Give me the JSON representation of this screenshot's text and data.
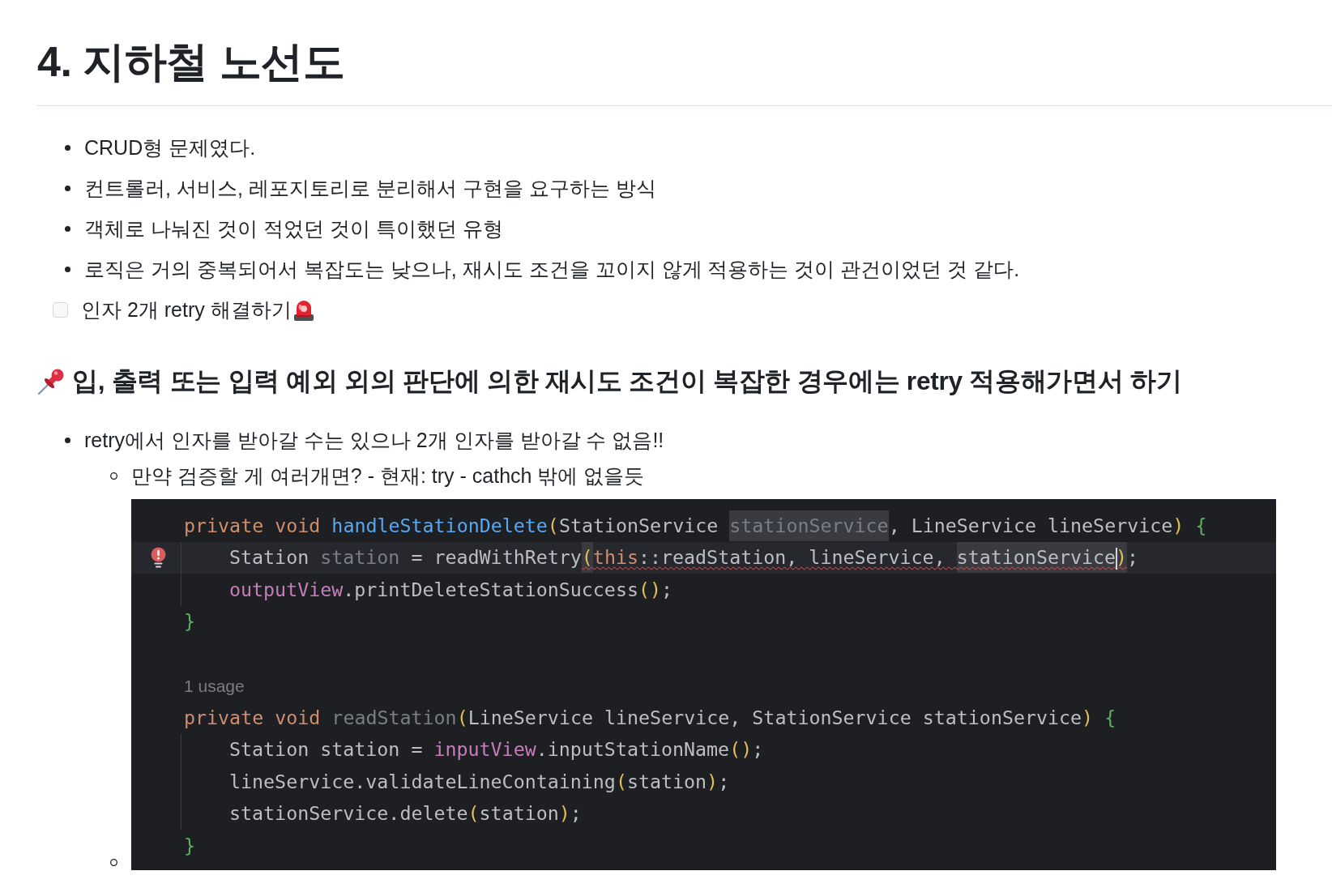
{
  "heading": "4. 지하철 노선도",
  "bullets": [
    "CRUD형 문제였다.",
    "컨트롤러, 서비스, 레포지토리로 분리해서 구현을 요구하는 방식",
    "객체로 나눠진 것이 적었던 것이 특이했던 유형",
    "로직은 거의 중복되어서 복잡도는 낮으나, 재시도 조건을 꼬이지 않게 적용하는 것이 관건이었던 것 같다."
  ],
  "todo": {
    "label": "인자 2개 retry 해결하기",
    "checked": false
  },
  "subheading": "입, 출력 또는 입력 예외 외의 판단에 의한 재시도 조건이 복잡한 경우에는 retry 적용해가면서 하기",
  "notes": [
    {
      "text": "retry에서 인자를 받아갈 수는 있으나 2개 인자를 받아갈 수 없음!!",
      "children": [
        {
          "kind": "text",
          "text": "만약 검증할 게 여러개면? - 현재: try - cathch 밖에 없을듯"
        },
        {
          "kind": "code",
          "lines": [
            {
              "kind": "code",
              "current": false,
              "indented": false,
              "error": false,
              "tokens": [
                {
                  "text": "private ",
                  "kind": "keyword",
                  "highlighted": false
                },
                {
                  "text": "void ",
                  "kind": "keyword",
                  "highlighted": false
                },
                {
                  "text": "handleStationDelete",
                  "kind": "declaration",
                  "highlighted": false
                },
                {
                  "text": "(",
                  "kind": "paren",
                  "highlighted": false
                },
                {
                  "text": "StationService ",
                  "kind": "plain",
                  "highlighted": false
                },
                {
                  "text": "stationService",
                  "kind": "unused",
                  "highlighted": true
                },
                {
                  "text": ", LineService lineService",
                  "kind": "plain",
                  "highlighted": false
                },
                {
                  "text": ") ",
                  "kind": "paren",
                  "highlighted": false
                },
                {
                  "text": "{",
                  "kind": "brace",
                  "highlighted": false
                }
              ]
            },
            {
              "kind": "code",
              "current": true,
              "indented": true,
              "error": true,
              "tokens": [
                {
                  "text": "Station ",
                  "kind": "plain",
                  "highlighted": false,
                  "squiggly": false
                },
                {
                  "text": "station",
                  "kind": "unused",
                  "highlighted": false,
                  "squiggly": false
                },
                {
                  "text": " = readWithRetry",
                  "kind": "plain",
                  "highlighted": false,
                  "squiggly": false
                },
                {
                  "text": "(",
                  "kind": "paren",
                  "highlighted": true,
                  "squiggly": true
                },
                {
                  "text": "this",
                  "kind": "keyword",
                  "highlighted": false,
                  "squiggly": true
                },
                {
                  "text": "::readStation, lineService, ",
                  "kind": "plain",
                  "highlighted": false,
                  "squiggly": true
                },
                {
                  "text": "stationService",
                  "kind": "plain",
                  "highlighted": true,
                  "squiggly": true
                },
                {
                  "kind": "caret"
                },
                {
                  "text": ")",
                  "kind": "paren",
                  "highlighted": true,
                  "squiggly": true
                },
                {
                  "text": ";",
                  "kind": "plain",
                  "highlighted": false,
                  "squiggly": false
                }
              ]
            },
            {
              "kind": "code",
              "current": false,
              "indented": true,
              "error": false,
              "tokens": [
                {
                  "text": "outputView",
                  "kind": "field"
                },
                {
                  "text": ".printDeleteStationSuccess",
                  "kind": "plain"
                },
                {
                  "text": "()",
                  "kind": "paren"
                },
                {
                  "text": ";",
                  "kind": "plain"
                }
              ]
            },
            {
              "kind": "code",
              "current": false,
              "indented": false,
              "error": false,
              "tokens": [
                {
                  "text": "}",
                  "kind": "brace"
                }
              ]
            },
            {
              "kind": "blank"
            },
            {
              "kind": "hint",
              "text": "1 usage"
            },
            {
              "kind": "code",
              "current": false,
              "indented": false,
              "error": false,
              "tokens": [
                {
                  "text": "private ",
                  "kind": "keyword"
                },
                {
                  "text": "void ",
                  "kind": "keyword"
                },
                {
                  "text": "readStation",
                  "kind": "unused"
                },
                {
                  "text": "(",
                  "kind": "paren"
                },
                {
                  "text": "LineService lineService, StationService stationService",
                  "kind": "plain"
                },
                {
                  "text": ") ",
                  "kind": "paren"
                },
                {
                  "text": "{",
                  "kind": "brace"
                }
              ]
            },
            {
              "kind": "code",
              "current": false,
              "indented": true,
              "error": false,
              "tokens": [
                {
                  "text": "Station station = ",
                  "kind": "plain"
                },
                {
                  "text": "inputView",
                  "kind": "field"
                },
                {
                  "text": ".inputStationName",
                  "kind": "plain"
                },
                {
                  "text": "()",
                  "kind": "paren"
                },
                {
                  "text": ";",
                  "kind": "plain"
                }
              ]
            },
            {
              "kind": "code",
              "current": false,
              "indented": true,
              "error": false,
              "tokens": [
                {
                  "text": "lineService.validateLineContaining",
                  "kind": "plain"
                },
                {
                  "text": "(",
                  "kind": "paren"
                },
                {
                  "text": "station",
                  "kind": "plain"
                },
                {
                  "text": ")",
                  "kind": "paren"
                },
                {
                  "text": ";",
                  "kind": "plain"
                }
              ]
            },
            {
              "kind": "code",
              "current": false,
              "indented": true,
              "error": false,
              "tokens": [
                {
                  "text": "stationService.delete",
                  "kind": "plain"
                },
                {
                  "text": "(",
                  "kind": "paren"
                },
                {
                  "text": "station",
                  "kind": "plain"
                },
                {
                  "text": ")",
                  "kind": "paren"
                },
                {
                  "text": ";",
                  "kind": "plain"
                }
              ]
            },
            {
              "kind": "code",
              "current": false,
              "indented": false,
              "error": false,
              "tokens": [
                {
                  "text": "}",
                  "kind": "brace"
                }
              ]
            }
          ]
        }
      ]
    }
  ]
}
